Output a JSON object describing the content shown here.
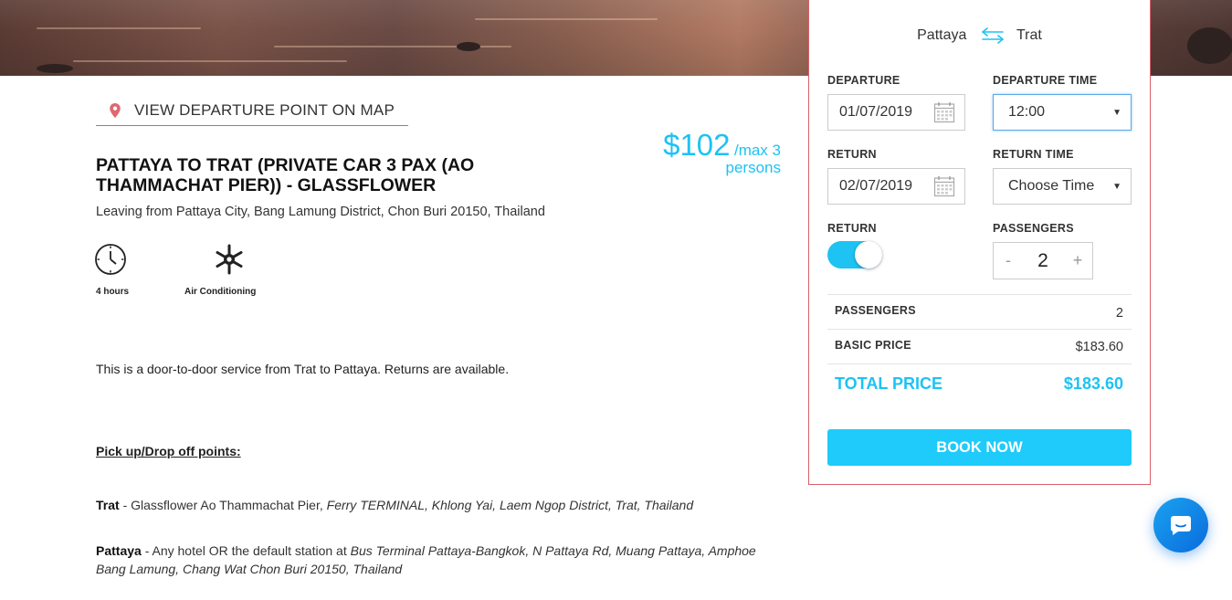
{
  "colors": {
    "accent": "#1ec2f3",
    "border_red": "#d9606a",
    "book_button": "#1ecbfb"
  },
  "map_link": {
    "label": "VIEW DEPARTURE POINT ON MAP",
    "icon": "map-pin-icon"
  },
  "trip": {
    "title": "PATTAYA TO TRAT (PRIVATE CAR 3 PAX (AO THAMMACHAT PIER)) - GLASSFLOWER",
    "address": "Leaving from Pattaya City, Bang Lamung District, Chon Buri 20150, Thailand",
    "price": "$102",
    "price_unit": "/max 3",
    "price_unit2": "persons"
  },
  "features": [
    {
      "icon": "clock-icon",
      "label": "4 hours"
    },
    {
      "icon": "snowflake-icon",
      "label": "Air Conditioning"
    }
  ],
  "description": "This is a door-to-door service from Trat to Pattaya. Returns are available.",
  "pickup": {
    "heading": "Pick up/Drop off points:",
    "points": [
      {
        "name": "Trat",
        "plain": " - Glassflower Ao Thammachat Pier, ",
        "italic": "Ferry TERMINAL, Khlong Yai, Laem Ngop District, Trat, Thailand"
      },
      {
        "name": "Pattaya",
        "plain": " - Any hotel OR the default station at ",
        "italic": "Bus Terminal Pattaya-Bangkok, N Pattaya Rd, Muang Pattaya, Amphoe Bang Lamung, Chang Wat Chon Buri 20150, Thailand"
      }
    ]
  },
  "booking": {
    "from": "Pattaya",
    "to": "Trat",
    "departure_label": "DEPARTURE",
    "departure_date": "01/07/2019",
    "departure_time_label": "DEPARTURE TIME",
    "departure_time": "12:00",
    "return_label": "RETURN",
    "return_date": "02/07/2019",
    "return_time_label": "RETURN TIME",
    "return_time": "Choose Time",
    "return_toggle_label": "RETURN",
    "return_toggle_on": true,
    "passengers_label": "PASSENGERS",
    "minus": "-",
    "plus": "+",
    "passengers": "2",
    "summary": {
      "passengers_label": "PASSENGERS",
      "passengers_value": "2",
      "basic_label": "BASIC PRICE",
      "basic_value": "$183.60",
      "total_label": "TOTAL PRICE",
      "total_value": "$183.60"
    },
    "book_label": "BOOK NOW"
  },
  "chat": {
    "icon": "chat-bubble-icon"
  }
}
